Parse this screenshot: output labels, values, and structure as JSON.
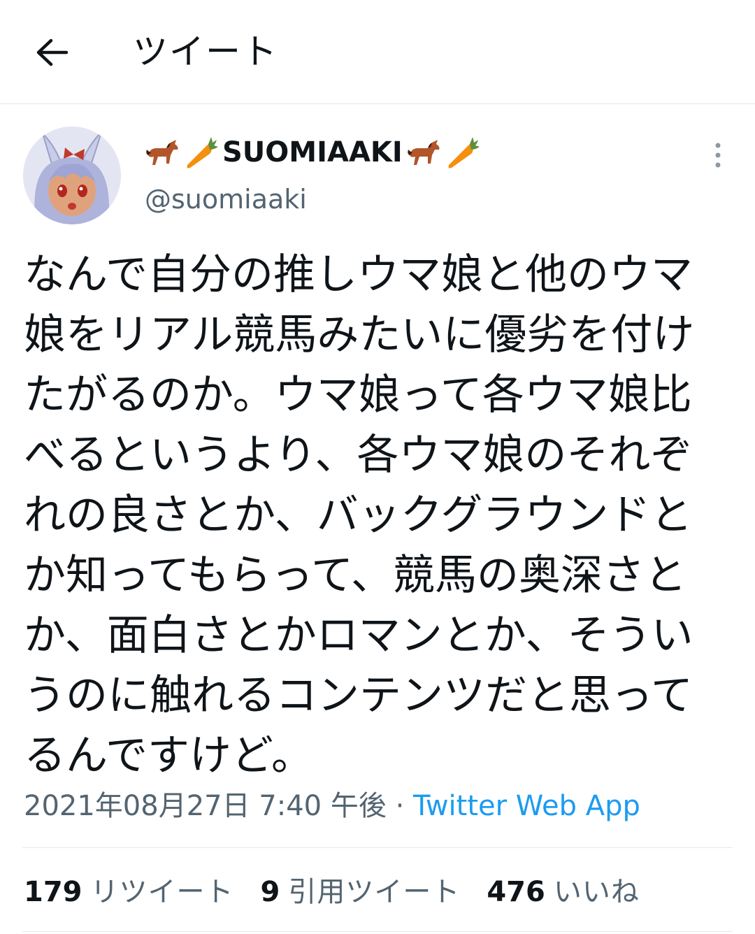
{
  "header": {
    "title": "ツイート",
    "back_icon": "arrow-left-icon"
  },
  "author": {
    "display_name": "SUOMIAAKI",
    "display_emoji": [
      "horse-emoji",
      "carrot-emoji"
    ],
    "handle": "@suomiaaki",
    "avatar": "anime-bunny-girl-avatar",
    "more_icon": "more-vertical-icon"
  },
  "tweet": {
    "lines": [
      "なんで自分の推しウマ娘と他のウマ",
      "娘をリアル競馬みたいに優劣を付け",
      "たがるのか。ウマ娘って各ウマ娘比",
      "べるというより、各ウマ娘のそれぞ",
      "れの良さとか、バックグラウンドと",
      "か知ってもらって、競馬の奥深さと",
      "か、面白さとかロマンとか、そうい",
      "うのに触れるコンテンツだと思って",
      "るんですけど。"
    ],
    "timestamp": "2021年08月27日 7:40 午後",
    "separator": " · ",
    "source": "Twitter Web App"
  },
  "stats": {
    "retweets_count": "179",
    "retweets_label": "リツイート",
    "quotes_count": "9",
    "quotes_label": "引用ツイート",
    "likes_count": "476",
    "likes_label": "いいね"
  },
  "colors": {
    "link": "#1d9bf0",
    "secondary_text": "#536471",
    "primary_text": "#0f1419",
    "divider": "#e6e6e6"
  }
}
